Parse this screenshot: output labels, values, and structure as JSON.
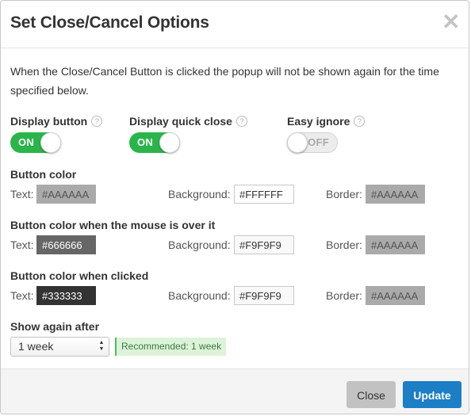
{
  "dialog": {
    "title": "Set Close/Cancel Options",
    "close_glyph": "✕",
    "intro": "When the Close/Cancel Button is clicked the popup will not be shown again for the time specified below."
  },
  "toggles": [
    {
      "label": "Display button",
      "help": "?",
      "state": "ON",
      "on": true
    },
    {
      "label": "Display quick close",
      "help": "?",
      "state": "ON",
      "on": true
    },
    {
      "label": "Easy ignore",
      "help": "?",
      "state": "OFF",
      "on": false
    }
  ],
  "labels": {
    "text": "Text:",
    "background": "Background:",
    "border": "Border:"
  },
  "color_sections": [
    {
      "title": "Button color",
      "text_color": "#AAAAAA",
      "background_color": "#FFFFFF",
      "border_color": "#AAAAAA"
    },
    {
      "title": "Button color when the mouse is over it",
      "text_color": "#666666",
      "background_color": "#F9F9F9",
      "border_color": "#AAAAAA"
    },
    {
      "title": "Button color when clicked",
      "text_color": "#333333",
      "background_color": "#F9F9F9",
      "border_color": "#AAAAAA"
    }
  ],
  "show_again": {
    "label": "Show again after",
    "selected": "1 week",
    "recommendation": "Recommended: 1 week"
  },
  "footer": {
    "close_label": "Close",
    "update_label": "Update"
  },
  "colors": {
    "toggle_on": "#29b54a",
    "primary": "#1c7ec5",
    "secondary_button": "#c2c2c2",
    "recommend_bg": "#ddf3d9"
  }
}
